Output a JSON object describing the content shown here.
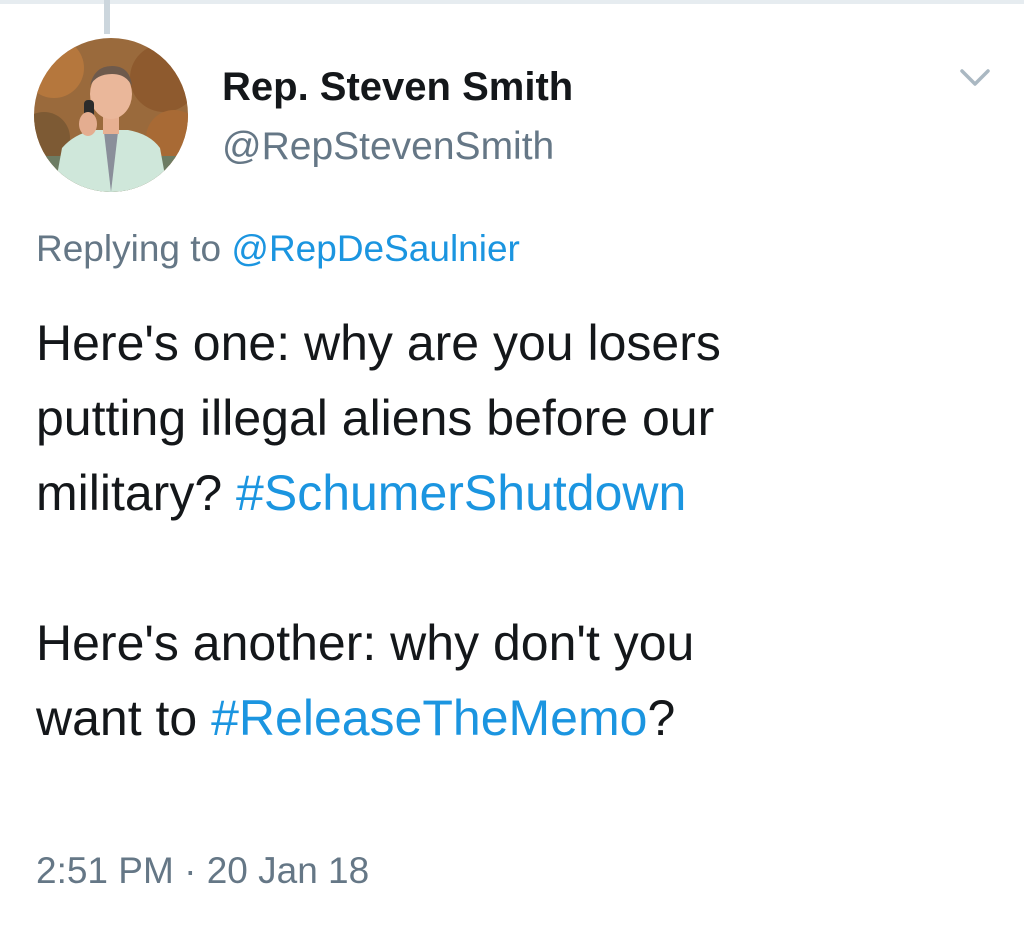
{
  "author": {
    "display_name": "Rep. Steven Smith",
    "handle": "@RepStevenSmith",
    "avatar_icon": "profile-photo"
  },
  "menu": {
    "icon": "chevron-down-icon"
  },
  "reply": {
    "prefix": "Replying to",
    "mention": "@RepDeSaulnier"
  },
  "tweet": {
    "paragraph1_line1": "Here's one: why are you losers",
    "paragraph1_line2": "putting illegal aliens before our",
    "paragraph1_line3_pre": "military? ",
    "paragraph1_hashtag": "#SchumerShutdown",
    "paragraph2_line1": "Here's another: why don't you",
    "paragraph2_line2_pre": "want to ",
    "paragraph2_hashtag": "#ReleaseTheMemo",
    "paragraph2_line2_post": "?"
  },
  "meta": {
    "time": "2:51 PM",
    "separator": " · ",
    "date": "20 Jan 18"
  },
  "colors": {
    "link": "#1b95e0",
    "secondary_text": "#657786",
    "primary_text": "#14171a"
  }
}
